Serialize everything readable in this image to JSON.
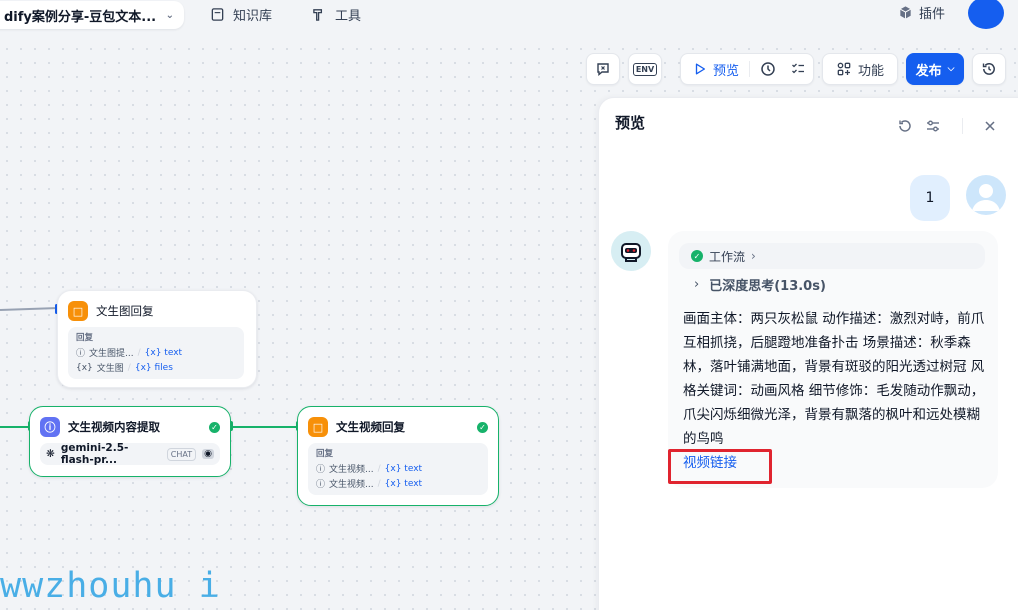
{
  "header": {
    "app_name": "dify案例分享-豆包文本...",
    "nav": [
      {
        "label": "知识库",
        "icon": "book-icon"
      },
      {
        "label": "工具",
        "icon": "hammer-icon"
      }
    ],
    "plugin_label": "插件"
  },
  "toolbar": {
    "preview_label": "预览",
    "features_label": "功能",
    "publish_label": "发布",
    "env_label": "ENV"
  },
  "nodes": {
    "image_reply": {
      "title": "文生图回复",
      "section": "回复",
      "rows": [
        {
          "name": "文生图提...",
          "var": "{x} text"
        },
        {
          "name": "文生图",
          "var": "{x} files"
        }
      ]
    },
    "video_extract": {
      "title": "文生视频内容提取",
      "model": "gemini-2.5-flash-pr...",
      "tag": "CHAT"
    },
    "video_reply": {
      "title": "文生视频回复",
      "section": "回复",
      "rows": [
        {
          "name": "文生视频...",
          "var": "{x} text"
        },
        {
          "name": "文生视频...",
          "var": "{x} text"
        }
      ]
    }
  },
  "preview_panel": {
    "title": "预览",
    "user_message": "1",
    "workflow_label": "工作流",
    "thinking_label": "已深度思考(13.0s)",
    "answer_text": "画面主体：两只灰松鼠 动作描述：激烈对峙，前爪互相抓挠，后腿蹬地准备扑击 场景描述：秋季森林，落叶铺满地面，背景有斑驳的阳光透过树冠 风格关键词：动画风格 细节修饰：毛发随动作飘动，爪尖闪烁细微光泽，背景有飘落的枫叶和远处模糊的鸟鸣",
    "video_link": "视频链接"
  },
  "watermark": "wwzhouhu i",
  "colors": {
    "primary": "#155eef",
    "success": "#17b26a",
    "highlight": "#e0242f"
  }
}
